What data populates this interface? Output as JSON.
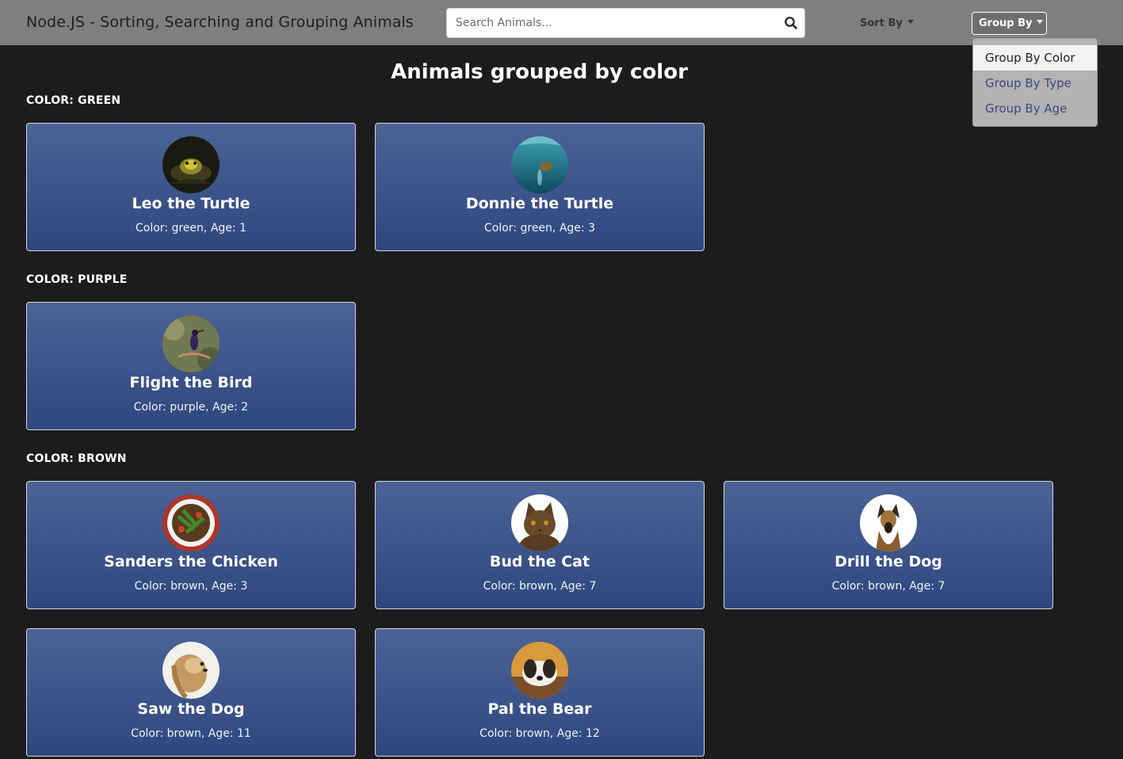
{
  "navbar": {
    "brand": "Node.JS - Sorting, Searching and Grouping Animals",
    "search_placeholder": "Search Animals...",
    "sort_label": "Sort By",
    "group_label": "Group By"
  },
  "dropdown": {
    "items": [
      {
        "label": "Group By Color",
        "active": true
      },
      {
        "label": "Group By Type",
        "active": false
      },
      {
        "label": "Group By Age",
        "active": false
      }
    ]
  },
  "page": {
    "heading": "Animals grouped by color"
  },
  "groups": [
    {
      "label": "COLOR: GREEN",
      "animals": [
        {
          "name": "Leo the Turtle",
          "info": "Color: green, Age: 1"
        },
        {
          "name": "Donnie the Turtle",
          "info": "Color: green, Age: 3"
        }
      ]
    },
    {
      "label": "COLOR: PURPLE",
      "animals": [
        {
          "name": "Flight the Bird",
          "info": "Color: purple, Age: 2"
        }
      ]
    },
    {
      "label": "COLOR: BROWN",
      "animals": [
        {
          "name": "Sanders the Chicken",
          "info": "Color: brown, Age: 3"
        },
        {
          "name": "Bud the Cat",
          "info": "Color: brown, Age: 7"
        },
        {
          "name": "Drill the Dog",
          "info": "Color: brown, Age: 7"
        },
        {
          "name": "Saw the Dog",
          "info": "Color: brown, Age: 11"
        },
        {
          "name": "Pal the Bear",
          "info": "Color: brown, Age: 12"
        }
      ]
    }
  ],
  "colors": {
    "navbar_bg": "#7f7f7f",
    "page_bg": "#1c1c1e",
    "card_top": "#4b6396",
    "card_bottom": "#2f477e",
    "dropdown_link": "#3a4a78"
  }
}
